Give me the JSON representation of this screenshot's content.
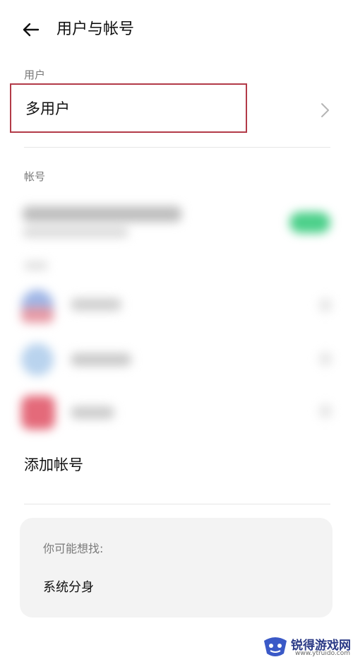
{
  "header": {
    "title": "用户与帐号"
  },
  "users_section": {
    "label": "用户",
    "multi_user": "多用户"
  },
  "accounts_section": {
    "label": "帐号",
    "add_account": "添加帐号"
  },
  "suggest": {
    "title": "你可能想找:",
    "item": "系统分身"
  },
  "watermark": {
    "name": "锐得游戏网",
    "url": "www.ytruido.com"
  },
  "colors": {
    "highlight": "#b23a48",
    "toggle_on": "#4cd08a"
  }
}
